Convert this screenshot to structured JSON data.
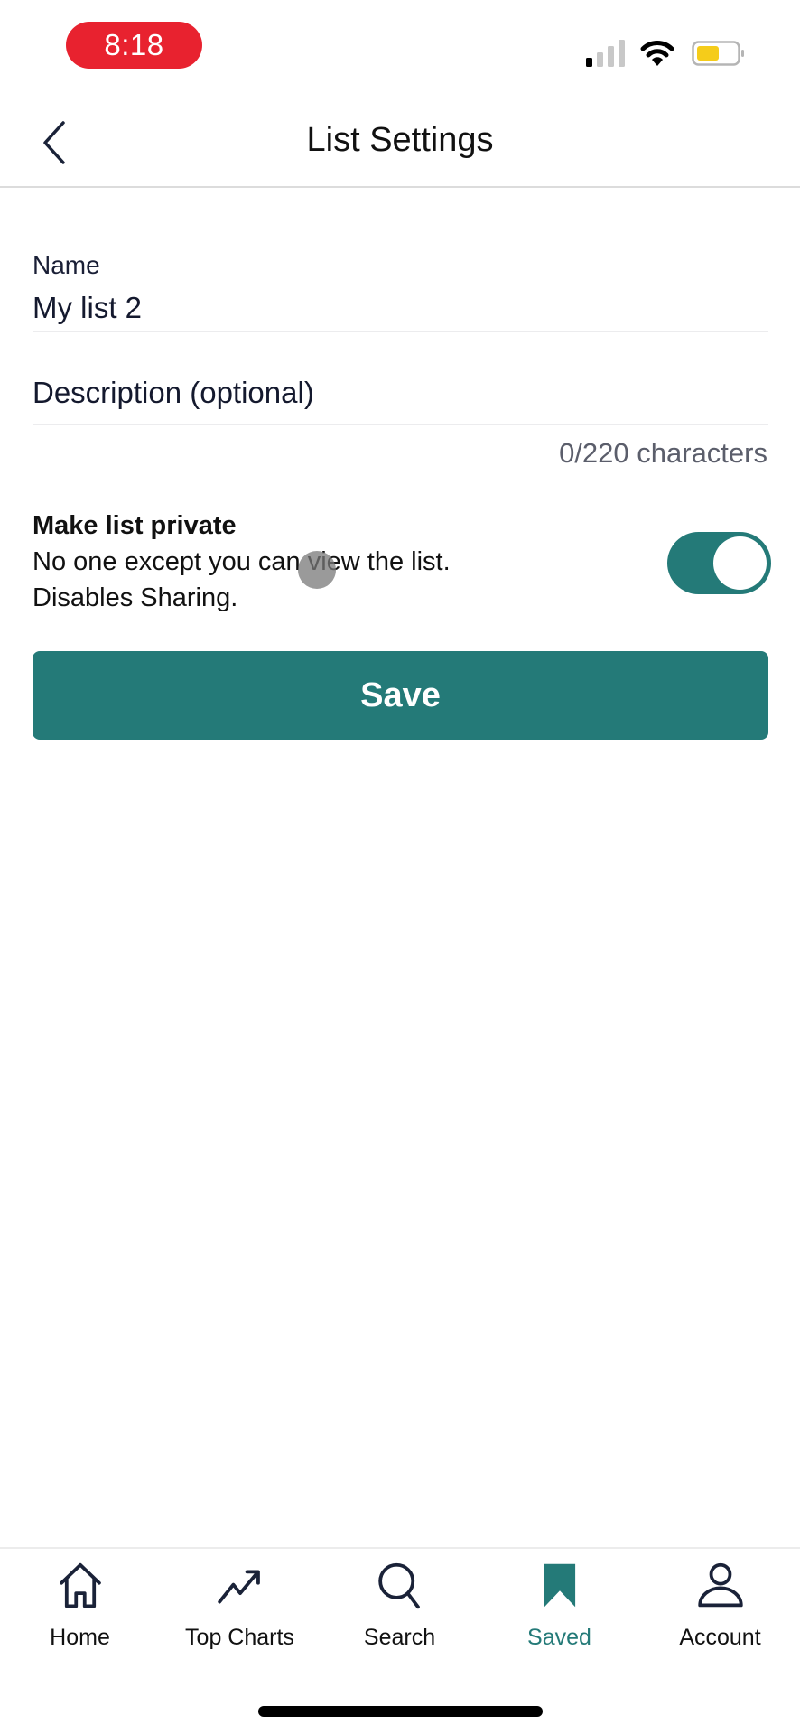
{
  "status_bar": {
    "time": "8:18",
    "icons": [
      "cellular-signal-icon",
      "wifi-icon",
      "battery-icon"
    ],
    "battery_color": "#f5cc1a"
  },
  "header": {
    "title": "List Settings",
    "back_icon": "chevron-left-icon"
  },
  "form": {
    "name_label": "Name",
    "name_value": "My list 2",
    "description_placeholder": "Description (optional)",
    "description_value": "",
    "char_counter": "0/220 characters",
    "private_title": "Make list private",
    "private_desc_line1": "No one except you can view the list.",
    "private_desc_line2": "Disables Sharing.",
    "private_enabled": true,
    "save_label": "Save"
  },
  "colors": {
    "accent": "#247a78",
    "time_pill": "#e8222f"
  },
  "bottom_nav": {
    "items": [
      {
        "label": "Home",
        "icon": "home-icon",
        "active": false
      },
      {
        "label": "Top Charts",
        "icon": "trending-up-icon",
        "active": false
      },
      {
        "label": "Search",
        "icon": "search-icon",
        "active": false
      },
      {
        "label": "Saved",
        "icon": "bookmark-icon",
        "active": true
      },
      {
        "label": "Account",
        "icon": "user-icon",
        "active": false
      }
    ]
  }
}
